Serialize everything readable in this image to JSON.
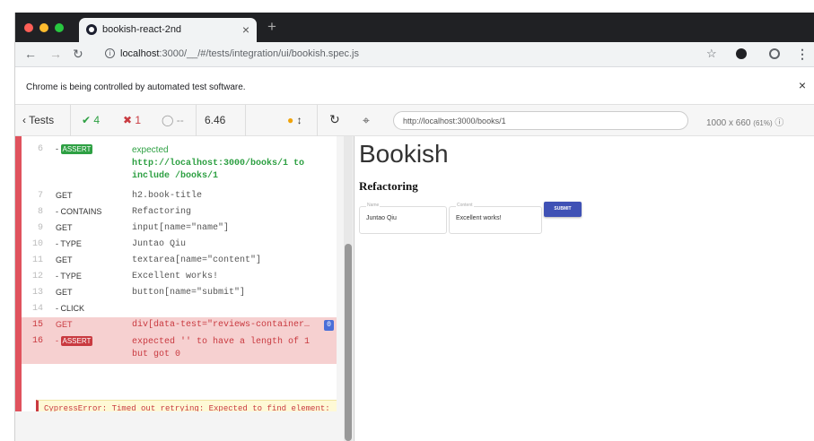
{
  "browser": {
    "tab_title": "bookish-react-2nd",
    "new_tab": "+",
    "tab_close": "×",
    "url_host": "localhost",
    "url_rest": ":3000/__/#/tests/integration/ui/bookish.spec.js",
    "info_bar": "Chrome is being controlled by automated test software.",
    "info_close": "×",
    "icons": [
      "back-icon",
      "forward-icon",
      "reload-icon",
      "info-icon",
      "star-icon",
      "cypress-icon",
      "account-icon",
      "menu-icon"
    ]
  },
  "reporter": {
    "tests_label": "Tests",
    "passed": "4",
    "failed": "1",
    "pending": "--",
    "duration": "6.46",
    "commands": [
      {
        "num": "6",
        "cmd": "- ASSERT",
        "badge": "ASSERT",
        "badge_color": "#2ea043",
        "msg": "expected",
        "msg2": "http://localhost:3000/books/1 to",
        "msg3": "include  /books/1"
      },
      {
        "num": "7",
        "cmd": "GET",
        "msg": "h2.book-title"
      },
      {
        "num": "8",
        "cmd": "- CONTAINS",
        "msg": "Refactoring"
      },
      {
        "num": "9",
        "cmd": "GET",
        "msg": "input[name=\"name\"]"
      },
      {
        "num": "10",
        "cmd": "- TYPE",
        "msg": "Juntao Qiu"
      },
      {
        "num": "11",
        "cmd": "GET",
        "msg": "textarea[name=\"content\"]"
      },
      {
        "num": "12",
        "cmd": "- TYPE",
        "msg": "Excellent works!"
      },
      {
        "num": "13",
        "cmd": "GET",
        "msg": "button[name=\"submit\"]"
      },
      {
        "num": "14",
        "cmd": "- CLICK",
        "msg": ""
      },
      {
        "num": "15",
        "cmd": "GET",
        "msg": "div[data-test=\"reviews-container…",
        "count": "0"
      },
      {
        "num": "16",
        "cmd": "- ASSERT",
        "badge": "ASSERT",
        "badge_color": "#c93a40",
        "msg": "expected '' to have a length of 1",
        "msg2": "but got 0"
      }
    ],
    "error": "CypressError: Timed out retrying: Expected to find element: 'div[data-test=\"reviews-container\"] .review', but never found it."
  },
  "aut": {
    "url": "http://localhost:3000/books/1",
    "viewport": "1000 x 660",
    "scale": "(61%)",
    "app": {
      "heading": "Bookish",
      "book_title": "Refactoring",
      "name_label": "Name",
      "name_value": "Juntao Qiu",
      "content_label": "Content",
      "content_value": "Excellent works!",
      "submit_label": "SUBMIT"
    }
  },
  "colors": {
    "fail": "#e0525d",
    "pass": "#2ea043",
    "submit": "#3f51b5",
    "chrome_dark": "#202124"
  }
}
